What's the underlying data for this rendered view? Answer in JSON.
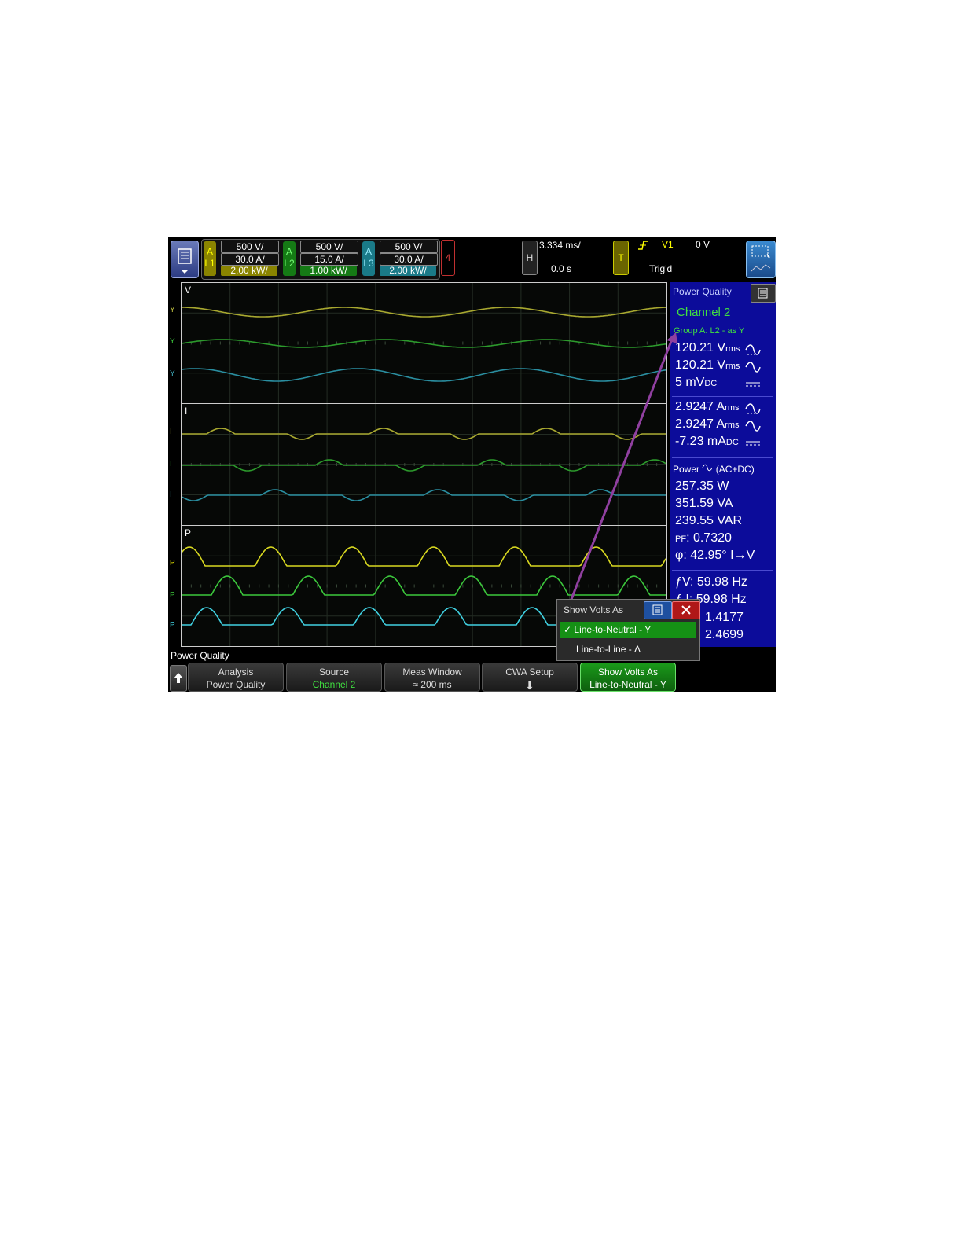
{
  "topbar": {
    "channels": [
      {
        "group": "A",
        "label": "L1",
        "volts": "500 V/",
        "amps": "30.0 A/",
        "power": "2.00 kW/",
        "color": "#c8c000",
        "power_bg": "#8a8400"
      },
      {
        "group": "A",
        "label": "L2",
        "volts": "500 V/",
        "amps": "15.0 A/",
        "power": "1.00 kW/",
        "color": "#22b022",
        "power_bg": "#157a15"
      },
      {
        "group": "A",
        "label": "L3",
        "volts": "500 V/",
        "amps": "30.0 A/",
        "power": "2.00 kW/",
        "color": "#2aa8b8",
        "power_bg": "#1a7a88"
      }
    ],
    "channel4": "4",
    "horizontal": {
      "label": "H",
      "scale": "3.334 ms/",
      "delay": "0.0 s"
    },
    "trigger": {
      "label": "T",
      "source": "V1",
      "level": "0 V",
      "status": "Trig'd",
      "edge_icon": "rising-edge-icon"
    }
  },
  "panes": [
    {
      "label": "V",
      "markers": [
        "Y",
        "Y",
        "Y"
      ]
    },
    {
      "label": "I",
      "markers": [
        "I",
        "I",
        "I"
      ]
    },
    {
      "label": "P",
      "markers": [
        "P",
        "P",
        "P"
      ]
    }
  ],
  "panel": {
    "title": "Power Quality",
    "channel": "Channel 2",
    "group": "Group A: L2 - as Y",
    "voltage": [
      {
        "value": "120.21 V",
        "unit": "rms",
        "icon": "ac-dc-icon"
      },
      {
        "value": "120.21 V",
        "unit": "rms",
        "icon": "ac-icon"
      },
      {
        "value": "5 mV",
        "unit": "DC",
        "icon": "dc-icon"
      }
    ],
    "current": [
      {
        "value": "2.9247 A",
        "unit": "rms",
        "icon": "ac-dc-icon"
      },
      {
        "value": "2.9247 A",
        "unit": "rms",
        "icon": "ac-icon"
      },
      {
        "value": "-7.23 mA",
        "unit": "DC",
        "icon": "dc-icon"
      }
    ],
    "power_heading": "Power",
    "power_mode": "(AC+DC)",
    "power": [
      "257.35 W",
      "351.59 VA",
      "239.55 VAR"
    ],
    "pf_label": "PF",
    "pf_value": ": 0.7320",
    "phase_symbol": "φ",
    "phase_value": ": 42.95° I→V",
    "freq_v_label": "ƒV",
    "freq_v": ": 59.98 Hz",
    "freq_i_label": "ƒ I",
    "freq_i": ": 59.98 Hz",
    "crest_v": "1.4177",
    "crest_i": "2.4699"
  },
  "popup": {
    "title": "Show Volts As",
    "options": [
      {
        "label": "Line-to-Neutral - Y",
        "selected": true
      },
      {
        "label": "Line-to-Line - Δ",
        "selected": false
      }
    ]
  },
  "softkeys": {
    "menu_title": "Power Quality",
    "keys": [
      {
        "l1": "Analysis",
        "l2": "Power Quality"
      },
      {
        "l1": "Source",
        "l2": "Channel 2"
      },
      {
        "l1": "Meas Window",
        "l2": "≈ 200 ms"
      },
      {
        "l1": "CWA Setup",
        "l2": "⬇"
      },
      {
        "l1": "Show Volts As",
        "l2": "Line-to-Neutral - Y"
      }
    ]
  },
  "colors": {
    "yellow": "#d8d820",
    "green": "#3cc83c",
    "cyan": "#40d0e0",
    "panel_bg": "#0c0c9a",
    "callout": "#9040a0"
  }
}
